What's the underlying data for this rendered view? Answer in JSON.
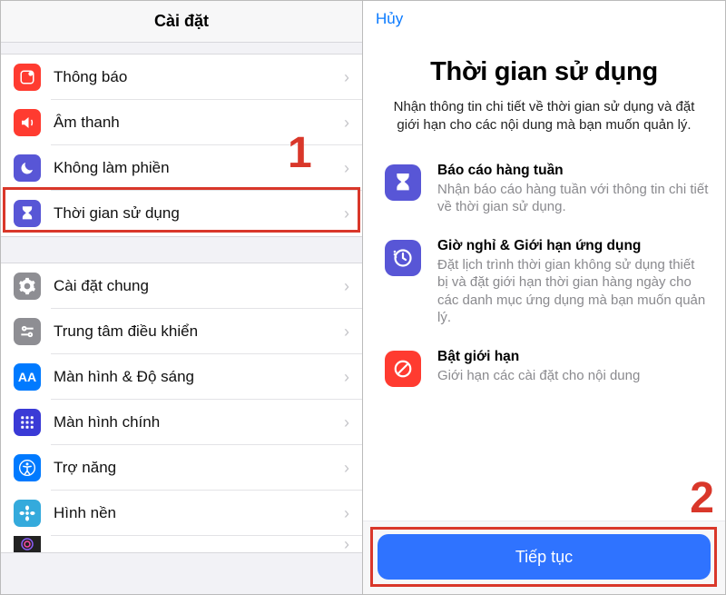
{
  "left": {
    "header": "Cài đặt",
    "group1": [
      {
        "name": "notifications",
        "label": "Thông báo",
        "icon": "notification-icon",
        "bg": "bg-red"
      },
      {
        "name": "sounds",
        "label": "Âm thanh",
        "icon": "sound-icon",
        "bg": "bg-red"
      },
      {
        "name": "dnd",
        "label": "Không làm phiền",
        "icon": "moon-icon",
        "bg": "bg-indigo"
      },
      {
        "name": "screentime",
        "label": "Thời gian sử dụng",
        "icon": "hourglass-icon",
        "bg": "bg-indigo"
      }
    ],
    "group2": [
      {
        "name": "general",
        "label": "Cài đặt chung",
        "icon": "gear-icon",
        "bg": "bg-gray"
      },
      {
        "name": "control-center",
        "label": "Trung tâm điều khiển",
        "icon": "switches-icon",
        "bg": "bg-gray"
      },
      {
        "name": "display",
        "label": "Màn hình & Độ sáng",
        "icon": "aa-icon",
        "bg": "bg-blue"
      },
      {
        "name": "home-screen",
        "label": "Màn hình chính",
        "icon": "grid-icon",
        "bg": "bg-indigo"
      },
      {
        "name": "accessibility",
        "label": "Trợ năng",
        "icon": "person-icon",
        "bg": "bg-accessible"
      },
      {
        "name": "wallpaper",
        "label": "Hình nền",
        "icon": "flower-icon",
        "bg": "bg-teal"
      },
      {
        "name": "siri",
        "label": "",
        "icon": "siri-icon",
        "bg": "bg-purple"
      }
    ]
  },
  "right": {
    "cancel": "Hủy",
    "title": "Thời gian sử dụng",
    "subtitle": "Nhận thông tin chi tiết về thời gian sử dụng và đặt giới hạn cho các nội dung mà bạn muốn quản lý.",
    "features": [
      {
        "name": "weekly-reports",
        "icon": "hourglass-icon",
        "bg": "bg-indigo",
        "title": "Báo cáo hàng tuần",
        "desc": "Nhận báo cáo hàng tuần với thông tin chi tiết về thời gian sử dụng."
      },
      {
        "name": "downtime-limits",
        "icon": "clock-icon",
        "bg": "bg-indigo",
        "title": "Giờ nghỉ & Giới hạn ứng dụng",
        "desc": "Đặt lịch trình thời gian không sử dụng thiết bị và đặt giới hạn thời gian hàng ngày cho các danh mục ứng dụng mà bạn muốn quản lý."
      },
      {
        "name": "restrictions",
        "icon": "restrict-icon",
        "bg": "bg-red",
        "title": "Bật giới hạn",
        "desc": "Giới hạn các cài đặt cho nội dung"
      }
    ],
    "continue": "Tiếp tục"
  },
  "annotations": {
    "step1": "1",
    "step2": "2"
  }
}
